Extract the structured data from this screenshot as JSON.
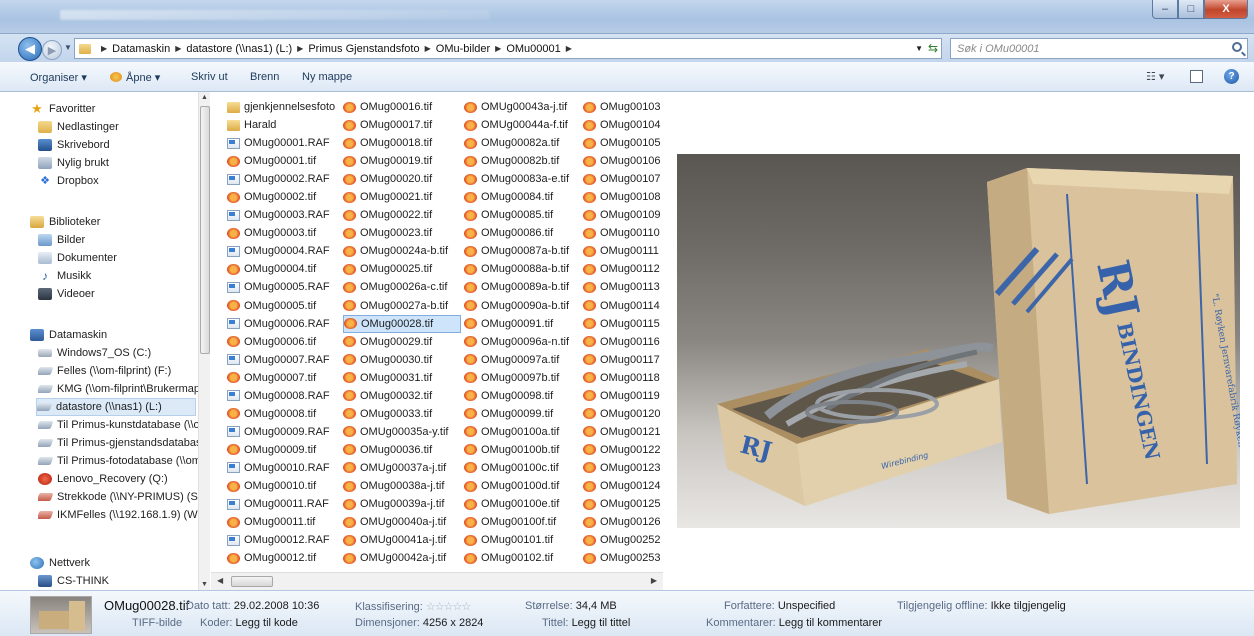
{
  "window": {
    "buttons": {
      "minimize": "–",
      "maximize": "□",
      "close": "X"
    }
  },
  "address": {
    "crumbs": [
      "Datamaskin",
      "datastore (\\\\nas1) (L:)",
      "Primus Gjenstandsfoto",
      "OMu-bilder",
      "OMu00001"
    ],
    "search_placeholder": "Søk i OMu00001"
  },
  "toolbar": {
    "organize": "Organiser ▾",
    "open": "Åpne ▾",
    "print": "Skriv ut",
    "burn": "Brenn",
    "new_folder": "Ny mappe"
  },
  "nav": {
    "items": [
      {
        "label": "Favoritter",
        "icon": "star-icon"
      },
      {
        "label": "Nedlastinger",
        "icon": "downloads-folder-icon"
      },
      {
        "label": "Skrivebord",
        "icon": "desktop-icon"
      },
      {
        "label": "Nylig brukt",
        "icon": "recent-places-icon"
      },
      {
        "label": "Dropbox",
        "icon": "dropbox-icon"
      },
      {
        "label": "Biblioteker",
        "icon": "libraries-icon"
      },
      {
        "label": "Bilder",
        "icon": "pictures-icon"
      },
      {
        "label": "Dokumenter",
        "icon": "documents-icon"
      },
      {
        "label": "Musikk",
        "icon": "music-icon"
      },
      {
        "label": "Videoer",
        "icon": "videos-icon"
      },
      {
        "label": "Datamaskin",
        "icon": "computer-icon"
      },
      {
        "label": "Windows7_OS (C:)",
        "icon": "local-drive-icon"
      },
      {
        "label": "Felles (\\\\om-filprint) (F:)",
        "icon": "network-drive-icon"
      },
      {
        "label": "KMG (\\\\om-filprint\\Brukermap",
        "icon": "network-drive-icon"
      },
      {
        "label": "datastore (\\\\nas1) (L:)",
        "icon": "network-drive-icon"
      },
      {
        "label": "Til Primus-kunstdatabase (\\\\o",
        "icon": "network-drive-icon"
      },
      {
        "label": "Til Primus-gjenstandsdatabase",
        "icon": "network-drive-icon"
      },
      {
        "label": "Til Primus-fotodatabase (\\\\om",
        "icon": "network-drive-icon"
      },
      {
        "label": "Lenovo_Recovery (Q:)",
        "icon": "recovery-drive-icon"
      },
      {
        "label": "Strekkode (\\\\NY-PRIMUS) (S:)",
        "icon": "disconnected-drive-icon"
      },
      {
        "label": "IKMFelles (\\\\192.168.1.9) (W:)",
        "icon": "disconnected-drive-icon"
      },
      {
        "label": "Nettverk",
        "icon": "network-icon"
      },
      {
        "label": "CS-THINK",
        "icon": "computer-host-icon"
      }
    ],
    "selected": "datastore (\\\\nas1) (L:)"
  },
  "files": {
    "columns": [
      [
        "gjenkjennelsesfoto",
        "Harald",
        "OMug00001.RAF",
        "OMug00001.tif",
        "OMug00002.RAF",
        "OMug00002.tif",
        "OMug00003.RAF",
        "OMug00003.tif",
        "OMug00004.RAF",
        "OMug00004.tif",
        "OMug00005.RAF",
        "OMug00005.tif",
        "OMug00006.RAF",
        "OMug00006.tif",
        "OMug00007.RAF",
        "OMug00007.tif",
        "OMug00008.RAF",
        "OMug00008.tif",
        "OMug00009.RAF",
        "OMug00009.tif",
        "OMug00010.RAF",
        "OMug00010.tif",
        "OMug00011.RAF",
        "OMug00011.tif",
        "OMug00012.RAF",
        "OMug00012.tif"
      ],
      [
        "OMug00016.tif",
        "OMug00017.tif",
        "OMug00018.tif",
        "OMug00019.tif",
        "OMug00020.tif",
        "OMug00021.tif",
        "OMug00022.tif",
        "OMug00023.tif",
        "OMug00024a-b.tif",
        "OMug00025.tif",
        "OMug00026a-c.tif",
        "OMug00027a-b.tif",
        "OMug00028.tif",
        "OMug00029.tif",
        "OMug00030.tif",
        "OMug00031.tif",
        "OMug00032.tif",
        "OMug00033.tif",
        "OMUg00035a-y.tif",
        "OMug00036.tif",
        "OMUg00037a-j.tif",
        "OMug00038a-j.tif",
        "OMug00039a-j.tif",
        "OMUg00040a-j.tif",
        "OMUg00041a-j.tif",
        "OMUg00042a-j.tif"
      ],
      [
        "OMUg00043a-j.tif",
        "OMUg00044a-f.tif",
        "OMug00082a.tif",
        "OMug00082b.tif",
        "OMug00083a-e.tif",
        "OMug00084.tif",
        "OMug00085.tif",
        "OMug00086.tif",
        "OMug00087a-b.tif",
        "OMug00088a-b.tif",
        "OMug00089a-b.tif",
        "OMug00090a-b.tif",
        "OMug00091.tif",
        "OMug00096a-n.tif",
        "OMug00097a.tif",
        "OMug00097b.tif",
        "OMug00098.tif",
        "OMug00099.tif",
        "OMug00100a.tif",
        "OMug00100b.tif",
        "OMug00100c.tif",
        "OMug00100d.tif",
        "OMug00100e.tif",
        "OMug00100f.tif",
        "OMug00101.tif",
        "OMug00102.tif"
      ],
      [
        "OMug00103",
        "OMug00104",
        "OMug00105",
        "OMug00106",
        "OMug00107",
        "OMug00108",
        "OMug00109",
        "OMug00110",
        "OMug00111",
        "OMug00112",
        "OMug00113",
        "OMug00114",
        "OMug00115",
        "OMug00116",
        "OMug00117",
        "OMug00118",
        "OMug00119",
        "OMug00120",
        "OMug00121",
        "OMug00122",
        "OMug00123",
        "OMug00124",
        "OMug00125",
        "OMug00126",
        "OMug00252",
        "OMug00253"
      ]
    ],
    "selected": "OMug00028.tif"
  },
  "preview": {
    "box_text_brand": "RJ",
    "box_text_word": "BINDINGEN",
    "box_text_maker": "\"L. Røyken Jernvarefabrik Røyken",
    "box_text_inner": "Wirebinding"
  },
  "details": {
    "filename": "OMug00028.tif",
    "filetype": "TIFF-bilde",
    "date_label": "Dato tatt:",
    "date_value": "29.02.2008 10:36",
    "tags_label": "Koder:",
    "tags_value": "Legg til kode",
    "rating_label": "Klassifisering:",
    "rating_value": "☆☆☆☆☆",
    "dims_label": "Dimensjoner:",
    "dims_value": "4256 x 2824",
    "size_label": "Størrelse:",
    "size_value": "34,4 MB",
    "title_label": "Tittel:",
    "title_value": "Legg til tittel",
    "authors_label": "Forfattere:",
    "authors_value": "Unspecified",
    "comments_label": "Kommentarer:",
    "comments_value": "Legg til kommentarer",
    "offline_label": "Tilgjengelig offline:",
    "offline_value": "Ikke tilgjengelig"
  }
}
